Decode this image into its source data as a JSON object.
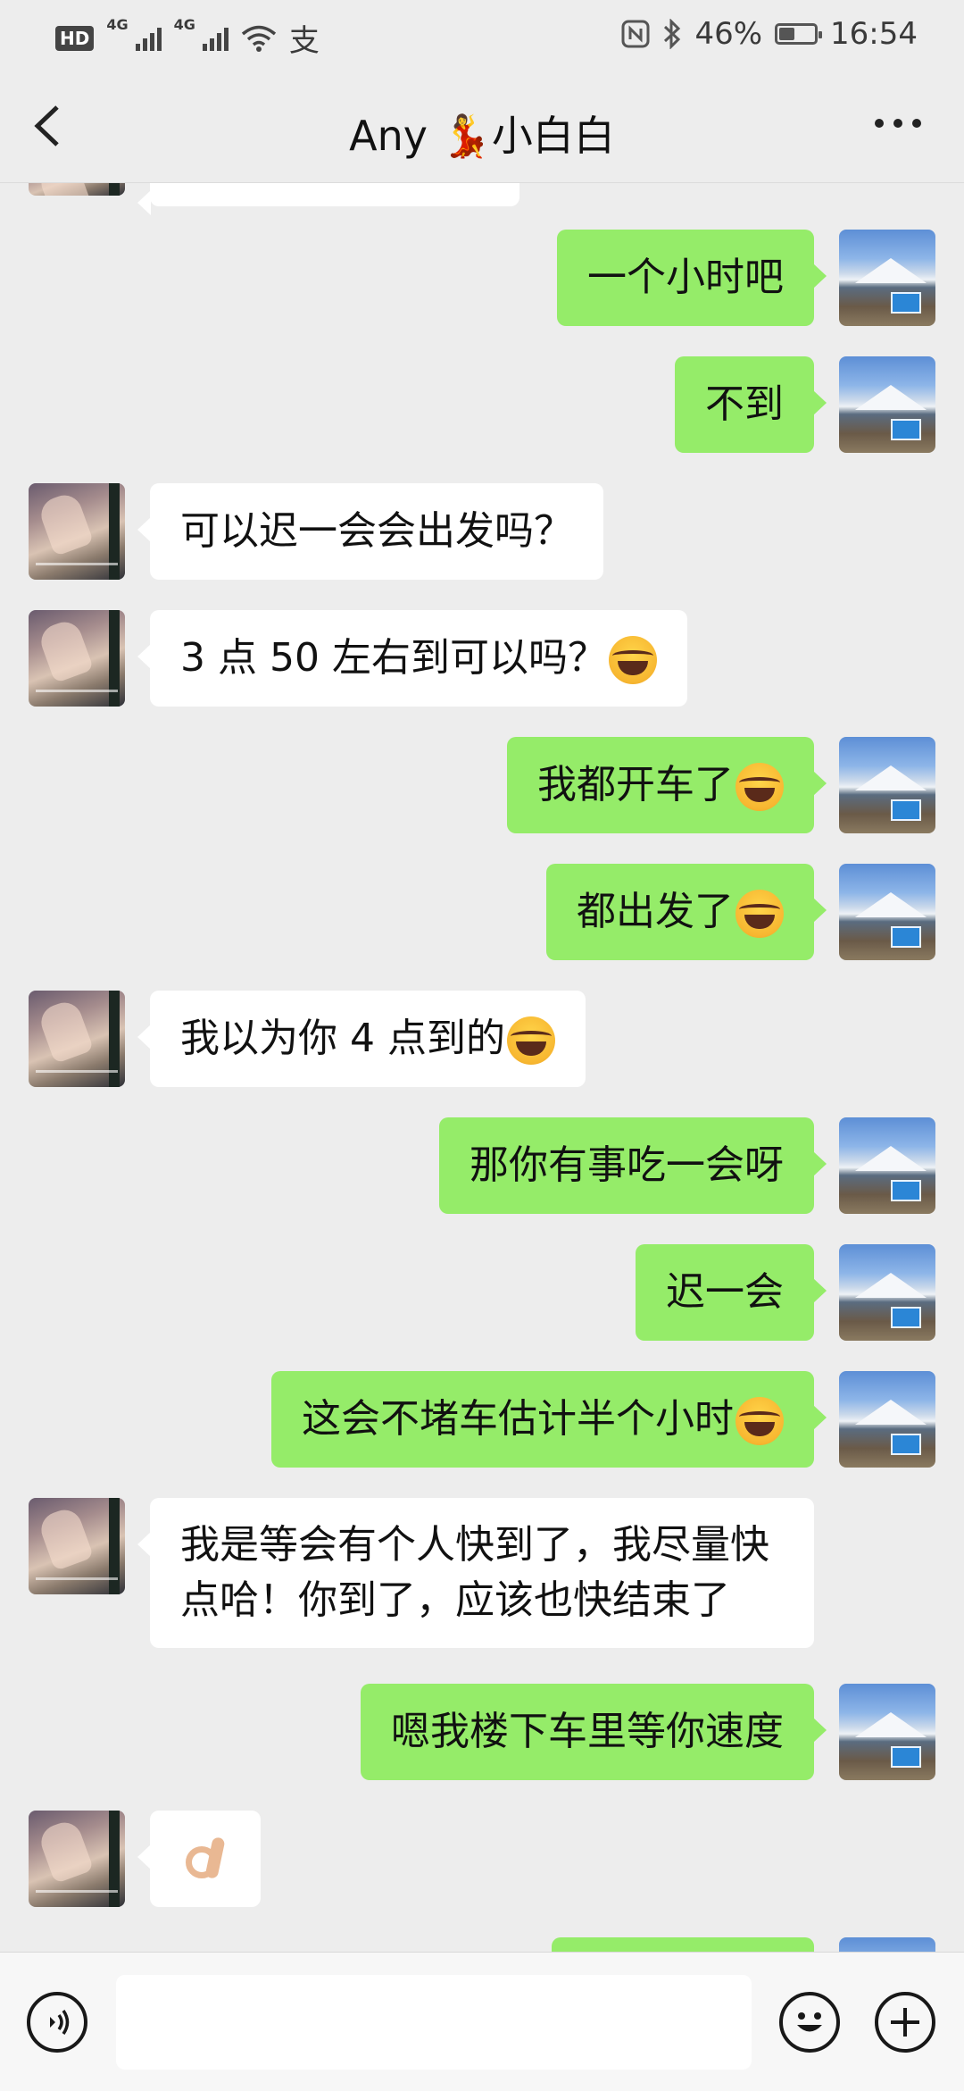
{
  "status_bar": {
    "left_badge": "HD",
    "network_1": "4G",
    "network_2": "4G",
    "pay_icon": "支",
    "battery": "46%",
    "battery_level": 0.46,
    "time": "16:54"
  },
  "header": {
    "title": "Any 💃小白白"
  },
  "messages": [
    {
      "side": "right",
      "text": "一个小时吧"
    },
    {
      "side": "right",
      "text": "不到"
    },
    {
      "side": "left",
      "text": "可以迟一会会出发吗？"
    },
    {
      "side": "left",
      "text": "3 点 50 左右到可以吗？",
      "emoji": "facepalm-cry-emoji"
    },
    {
      "side": "right",
      "text": "我都开车了",
      "emoji": "facepalm-cry-emoji"
    },
    {
      "side": "right",
      "text": "都出发了",
      "emoji": "facepalm-cry-emoji"
    },
    {
      "side": "left",
      "text": "我以为你 4 点到的",
      "emoji": "facepalm-cry-emoji"
    },
    {
      "side": "right",
      "text": "那你有事吃一会呀"
    },
    {
      "side": "right",
      "text": "迟一会"
    },
    {
      "side": "right",
      "text": "这会不堵车估计半个小时",
      "emoji": "facepalm-cry-emoji"
    },
    {
      "side": "left",
      "line1": "我是等会有个人快到了，我尽量快",
      "line2": "点哈！你到了，应该也快结束了"
    },
    {
      "side": "right",
      "text": "嗯我楼下车里等你速度"
    },
    {
      "side": "left",
      "emoji": "ok-hand-emoji"
    }
  ],
  "input_bar": {
    "placeholder": ""
  },
  "colors": {
    "background": "#ededed",
    "self_bubble": "#95ec69",
    "peer_bubble": "#ffffff"
  }
}
